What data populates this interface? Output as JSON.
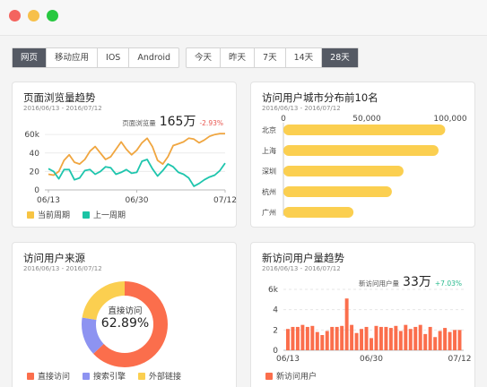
{
  "window": {
    "dots": [
      "#f4645f",
      "#f7c04a",
      "#28c840"
    ]
  },
  "filters": {
    "platform": [
      "网页",
      "移动应用",
      "IOS",
      "Android"
    ],
    "platform_active": 0,
    "range": [
      "今天",
      "昨天",
      "7天",
      "14天",
      "28天"
    ],
    "range_active": 4
  },
  "cards": {
    "pageviews": {
      "title": "页面浏览量趋势",
      "date": "2016/06/13 - 2016/07/12",
      "stat_label": "页面浏览量",
      "stat_value": "165万",
      "stat_change": "-2.93%",
      "stat_change_color": "#e8554e",
      "legend": [
        {
          "label": "当前周期",
          "color": "#f7c443"
        },
        {
          "label": "上一周期",
          "color": "#1bc4a5"
        }
      ]
    },
    "cities": {
      "title": "访问用户城市分布前10名",
      "date": "2016/06/13 - 2016/07/12"
    },
    "sources": {
      "title": "访问用户来源",
      "date": "2016/06/13 - 2016/07/12",
      "center_label": "直接访问",
      "center_value": "62.89%",
      "legend": [
        {
          "label": "直接访问",
          "color": "#fb6e4c"
        },
        {
          "label": "搜索引擎",
          "color": "#8d93f1"
        },
        {
          "label": "外部链接",
          "color": "#fbcf50"
        }
      ]
    },
    "newusers": {
      "title": "新访问用户量趋势",
      "date": "2016/06/13 - 2016/07/12",
      "stat_label": "新访问用户量",
      "stat_value": "33万",
      "stat_change": "+7.03%",
      "stat_change_color": "#27b98c",
      "legend": [
        {
          "label": "新访问用户",
          "color": "#fb6e4c"
        }
      ]
    }
  },
  "chart_data": [
    {
      "type": "line",
      "x_ticks": [
        "06/13",
        "06/30",
        "07/12"
      ],
      "y_ticks": [
        "0",
        "20",
        "40",
        "60k"
      ],
      "ylim": [
        0,
        65
      ],
      "series": [
        {
          "name": "当前周期",
          "color": "#f0a640",
          "values": [
            17,
            16,
            20,
            32,
            38,
            30,
            28,
            33,
            42,
            47,
            40,
            33,
            36,
            44,
            52,
            44,
            38,
            43,
            51,
            56,
            47,
            32,
            28,
            36,
            48,
            50,
            52,
            56,
            55,
            51,
            54,
            58,
            60,
            61,
            61
          ]
        },
        {
          "name": "上一周期",
          "color": "#1ec5ad",
          "values": [
            23,
            20,
            12,
            22,
            22,
            11,
            13,
            21,
            22,
            17,
            20,
            25,
            24,
            17,
            19,
            22,
            18,
            19,
            31,
            33,
            23,
            15,
            21,
            28,
            25,
            19,
            17,
            13,
            4,
            7,
            11,
            14,
            16,
            21,
            29
          ]
        }
      ]
    },
    {
      "type": "bar",
      "orientation": "horizontal",
      "categories": [
        "北京",
        "上海",
        "深圳",
        "杭州",
        "广州"
      ],
      "values": [
        97000,
        93000,
        72000,
        65000,
        42000
      ],
      "x_ticks": [
        "0",
        "50,000",
        "100,000"
      ],
      "xlim": [
        0,
        100000
      ],
      "color": "#fbcf50"
    },
    {
      "type": "pie",
      "categories": [
        "直接访问",
        "搜索引擎",
        "外部链接"
      ],
      "values": [
        62.89,
        14.5,
        22.61
      ],
      "colors": [
        "#fb6e4c",
        "#8d93f1",
        "#fbcf50"
      ]
    },
    {
      "type": "bar",
      "x_ticks": [
        "06/13",
        "06/30",
        "07/12"
      ],
      "y_ticks": [
        "0",
        "2",
        "4",
        "6k"
      ],
      "ylim": [
        0,
        6
      ],
      "values": [
        2.1,
        2.3,
        2.3,
        2.5,
        2.3,
        2.4,
        1.8,
        1.5,
        1.9,
        2.3,
        2.3,
        2.4,
        5.1,
        2.5,
        1.7,
        2.1,
        2.3,
        1.2,
        2.4,
        2.3,
        2.3,
        2.2,
        2.4,
        1.9,
        2.5,
        2.1,
        2.3,
        2.5,
        1.6,
        2.3,
        1.3,
        1.9,
        2.2,
        1.8,
        2.0,
        2.0
      ],
      "color": "#fb6e4c"
    }
  ]
}
